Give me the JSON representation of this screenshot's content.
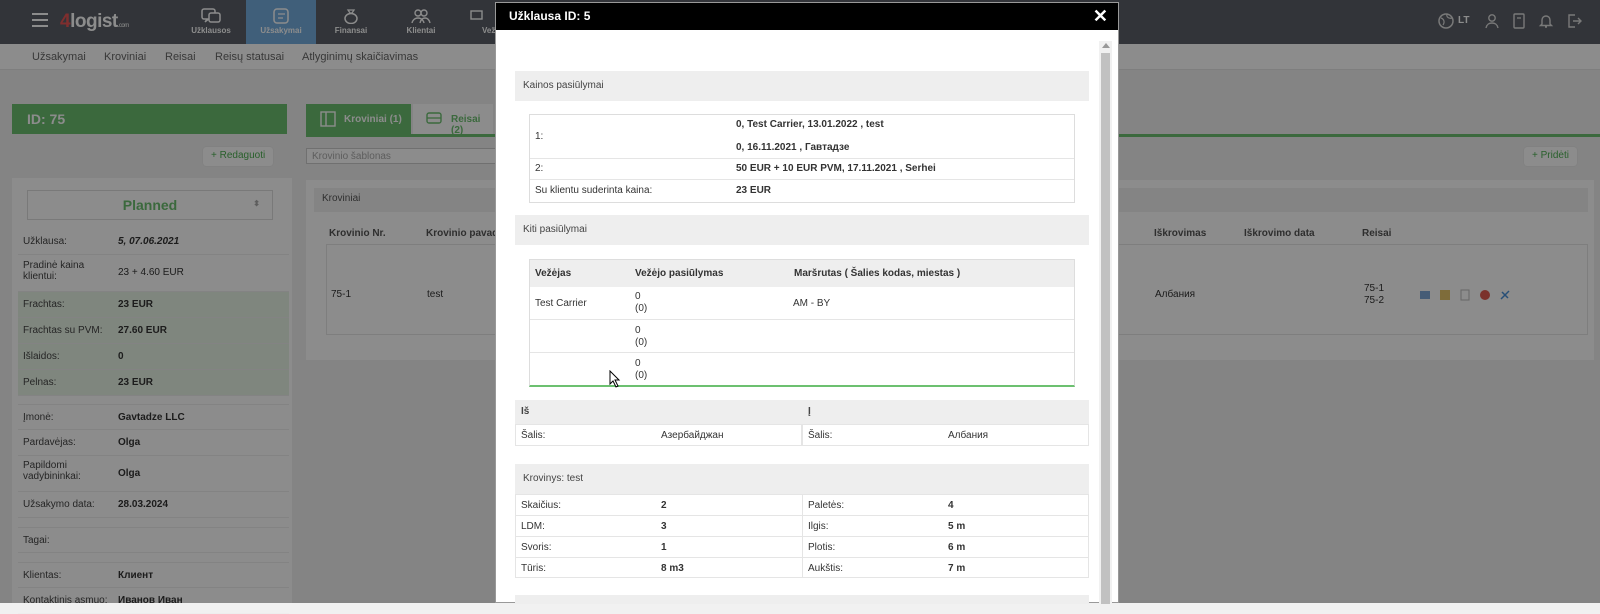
{
  "topbar": {
    "logo_prefix": "4",
    "logo_text": "logist",
    "logo_suffix": ".com",
    "nav": [
      {
        "label": "Užklausos",
        "icon": "chat-question-icon"
      },
      {
        "label": "Užsakymai",
        "icon": "orders-icon"
      },
      {
        "label": "Finansai",
        "icon": "money-bag-icon"
      },
      {
        "label": "Klientai",
        "icon": "people-icon"
      },
      {
        "label": "Vež",
        "icon": "truck-icon"
      }
    ],
    "lang": "LT"
  },
  "subnav": [
    "Užsakymai",
    "Kroviniai",
    "Reisai",
    "Reisų statusai",
    "Atlyginimų skaičiavimas"
  ],
  "left": {
    "id_title": "ID: 75",
    "edit_button": "+ Redaguoti",
    "status": "Planned",
    "rows": [
      {
        "k": "Užklausa:",
        "v": "5, 07.06.2021"
      },
      {
        "k": "Pradinė kaina klientui:",
        "v": "23 + 4.60 EUR"
      },
      {
        "k": "Frachtas:",
        "v": "23 EUR"
      },
      {
        "k": "Frachtas su PVM:",
        "v": "27.60 EUR"
      },
      {
        "k": "Išlaidos:",
        "v": "0"
      },
      {
        "k": "Pelnas:",
        "v": "23 EUR"
      },
      {
        "k": "Įmonė:",
        "v": "Gavtadze LLC"
      },
      {
        "k": "Pardavėjas:",
        "v": "Olga"
      },
      {
        "k": "Papildomi vadybininkai:",
        "v": "Olga"
      },
      {
        "k": "Užsakymo data:",
        "v": "28.03.2024"
      },
      {
        "k": "Tagai:",
        "v": ""
      },
      {
        "k": "Klientas:",
        "v": "Клиент"
      },
      {
        "k": "Kontaktinis asmuo:",
        "v": "Иванов Иван"
      }
    ]
  },
  "main": {
    "tab_cargo": "Kroviniai (1)",
    "tab_trips": "Reisai (2)",
    "search_placeholder": "Krovinio šablonas",
    "add_button": "+ Pridėti",
    "panel_title": "Kroviniai",
    "headers": [
      "Krovinio Nr.",
      "Krovinio pavad",
      "Iškrovimas",
      "Iškrovimo data",
      "Reisai"
    ],
    "row": {
      "nr": "75-1",
      "name": "test",
      "unload": "Албания",
      "trips1": "75-1",
      "trips2": "75-2"
    }
  },
  "modal": {
    "title": "Užklausa ID: 5",
    "price_offers_title": "Kainos pasiūlymai",
    "offers": [
      {
        "n": "1:",
        "l1": "0, Test Carrier, 13.01.2022 , test",
        "l2": "0, 16.11.2021 , Гавтадзе"
      },
      {
        "n": "2:",
        "l1": "50 EUR + 10 EUR PVM, 17.11.2021 , Serhei"
      }
    ],
    "agreed_label": "Su klientu suderinta kaina:",
    "agreed_value": "23 EUR",
    "other_title": "Kiti pasiūlymai",
    "other_headers": [
      "Vežėjas",
      "Vežėjo pasiūlymas",
      "Maršrutas ( Šalies kodas, miestas )"
    ],
    "other_rows": [
      {
        "carrier": "Test Carrier",
        "offer": "0",
        "sub": "(0)",
        "route": "AM - BY"
      },
      {
        "carrier": "",
        "offer": "0",
        "sub": "(0)",
        "route": ""
      },
      {
        "carrier": "",
        "offer": "0",
        "sub": "(0)",
        "route": ""
      }
    ],
    "from_title": "Iš",
    "to_title": "Į",
    "country_label": "Šalis:",
    "from_country": "Азербайджан",
    "to_country": "Албания",
    "cargo_title": "Krovinys: test",
    "cargo_left": [
      {
        "k": "Skaičius:",
        "v": "2"
      },
      {
        "k": "LDM:",
        "v": "3"
      },
      {
        "k": "Svoris:",
        "v": "1"
      },
      {
        "k": "Tūris:",
        "v": "8 m3"
      }
    ],
    "cargo_right": [
      {
        "k": "Paletės:",
        "v": "4"
      },
      {
        "k": "Ilgis:",
        "v": "5 m"
      },
      {
        "k": "Plotis:",
        "v": "6 m"
      },
      {
        "k": "Aukštis:",
        "v": "7 m"
      }
    ]
  }
}
